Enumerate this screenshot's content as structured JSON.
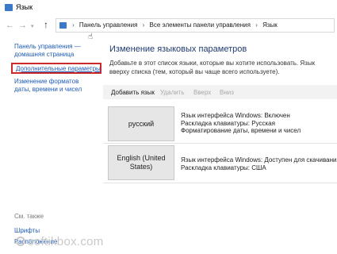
{
  "window": {
    "title": "Язык"
  },
  "nav": {
    "back": "←",
    "forward": "→",
    "dropdown": "▾",
    "up": "↑",
    "breadcrumbs": [
      "Панель управления",
      "Все элементы панели управления",
      "Язык"
    ],
    "separator": "›"
  },
  "sidebar": {
    "home_link": "Панель управления — домашняя страница",
    "advanced_link": "Дополнительные параметры",
    "formats_link": "Изменение форматов даты, времени и чисел",
    "see_also": "См. также",
    "fonts_link": "Шрифты",
    "extra_link": "Расположение"
  },
  "main": {
    "title": "Изменение языковых параметров",
    "description": "Добавьте в этот список языки, которые вы хотите использовать. Язык вверху списка (тем, который вы чаще всего используете).",
    "toolbar": {
      "add": "Добавить язык",
      "delete": "Удалить",
      "up": "Вверх",
      "down": "Вниз"
    },
    "languages": [
      {
        "name": "русский",
        "info": [
          "Язык интерфейса Windows: Включен",
          "Раскладка клавиатуры: Русская",
          "Форматирование даты, времени и чисел"
        ]
      },
      {
        "name": "English (United States)",
        "info": [
          "Язык интерфейса Windows: Доступен для скачивания",
          "Раскладка клавиатуры: США"
        ]
      }
    ]
  },
  "watermark": "softikbox.com",
  "colors": {
    "accent": "#1e5bb8",
    "highlight_box": "#cc2b2b",
    "toolbar_bg": "#f2f2f2",
    "tile_bg": "#e6e6e6"
  }
}
